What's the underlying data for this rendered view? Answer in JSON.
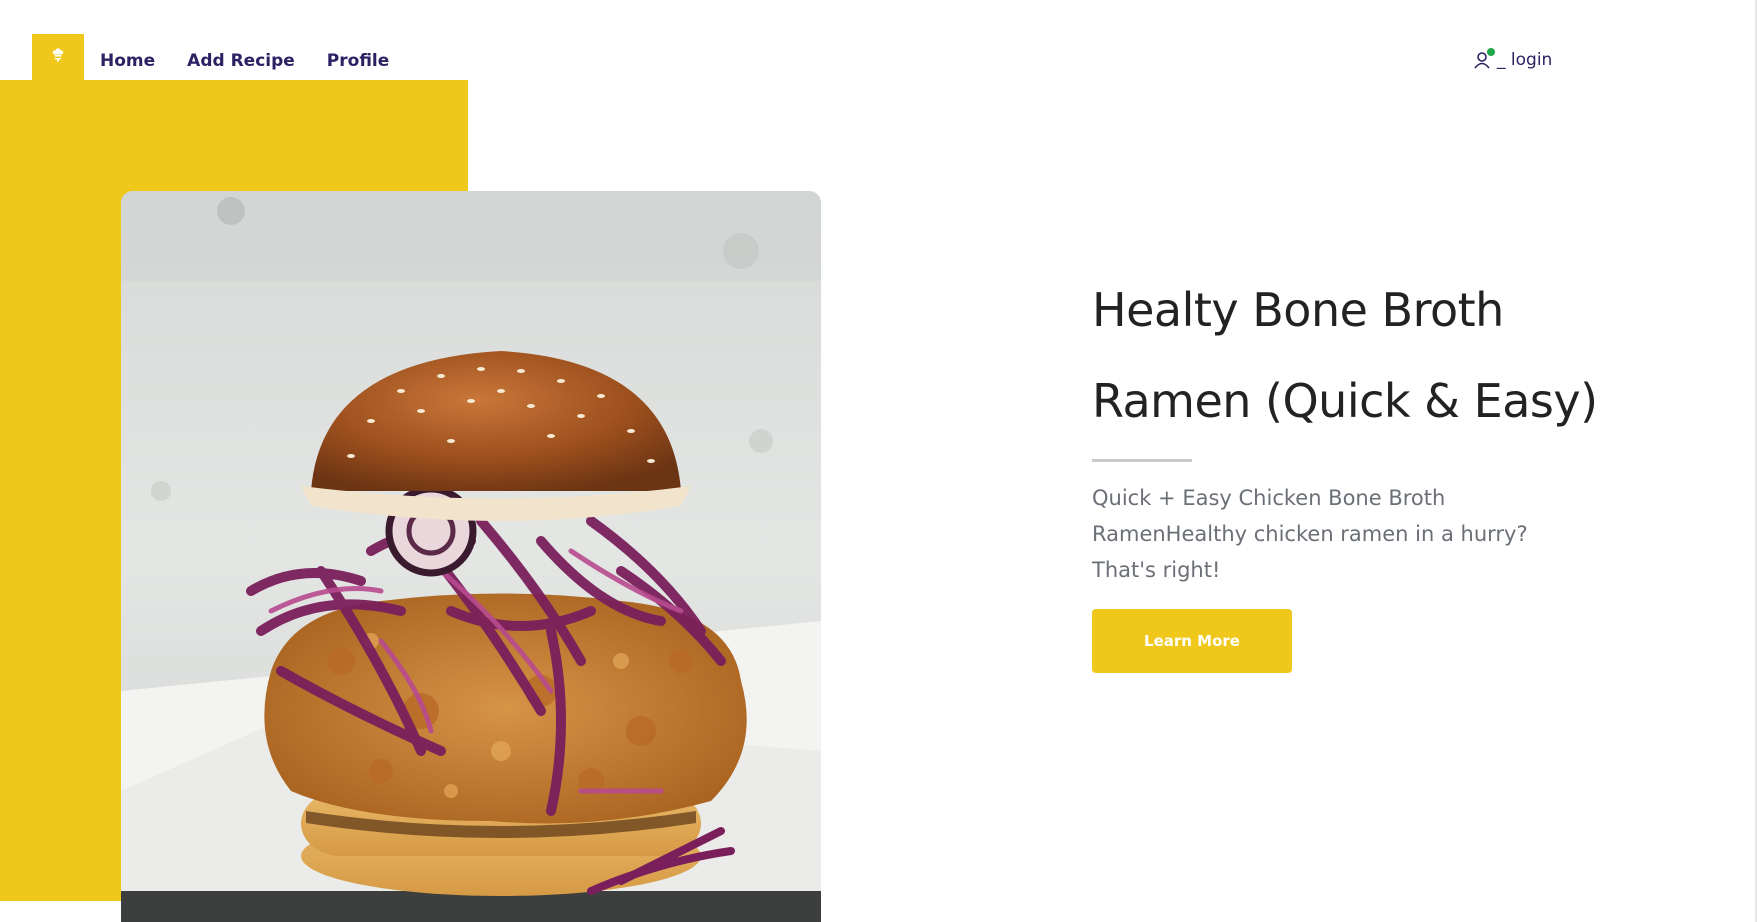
{
  "nav": {
    "logo_icon": "chef-hat-icon",
    "items": [
      {
        "label": "Home"
      },
      {
        "label": "Add Recipe"
      },
      {
        "label": "Profile"
      }
    ]
  },
  "login": {
    "icon": "user-icon",
    "label": "_ login",
    "status_color": "#1ea84a"
  },
  "hero": {
    "title_line1": "Healty Bone Broth",
    "title_line2": "Ramen (Quick & Easy)",
    "description": "Quick + Easy Chicken Bone Broth RamenHealthy chicken ramen in a hurry? That's right!",
    "button_label": "Learn More",
    "image_subject": "fried-chicken-burger-image"
  },
  "colors": {
    "accent": "#f0c81c",
    "nav_text": "#2b2263",
    "title_text": "#222222",
    "body_text": "#6b6f76"
  }
}
